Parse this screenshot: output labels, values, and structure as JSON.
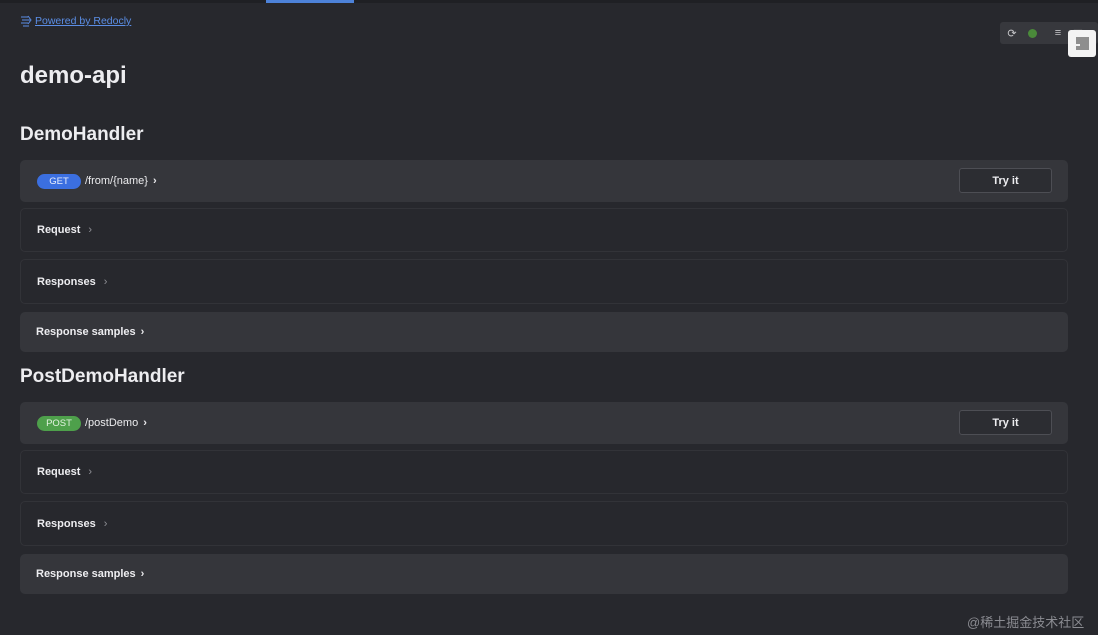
{
  "powered_by": "Powered by Redocly",
  "page_title": "demo-api",
  "groups": [
    {
      "title": "DemoHandler",
      "method": "GET",
      "path": "/from/{name}",
      "try_label": "Try it",
      "sections": [
        "Request",
        "Responses",
        "Response samples"
      ]
    },
    {
      "title": "PostDemoHandler",
      "method": "POST",
      "path": "/postDemo",
      "try_label": "Try it",
      "sections": [
        "Request",
        "Responses",
        "Response samples"
      ]
    }
  ],
  "toolbar": {
    "icons": [
      "refresh-icon",
      "status-dot-icon",
      "list-icon",
      "panel-icon"
    ],
    "status_color": "#4a8a3a"
  },
  "colors": {
    "background": "#27282d",
    "get_badge": "#3b6fe0",
    "post_badge": "#4ea04b",
    "link": "#5b8ee6"
  },
  "watermark": "@稀土掘金技术社区"
}
